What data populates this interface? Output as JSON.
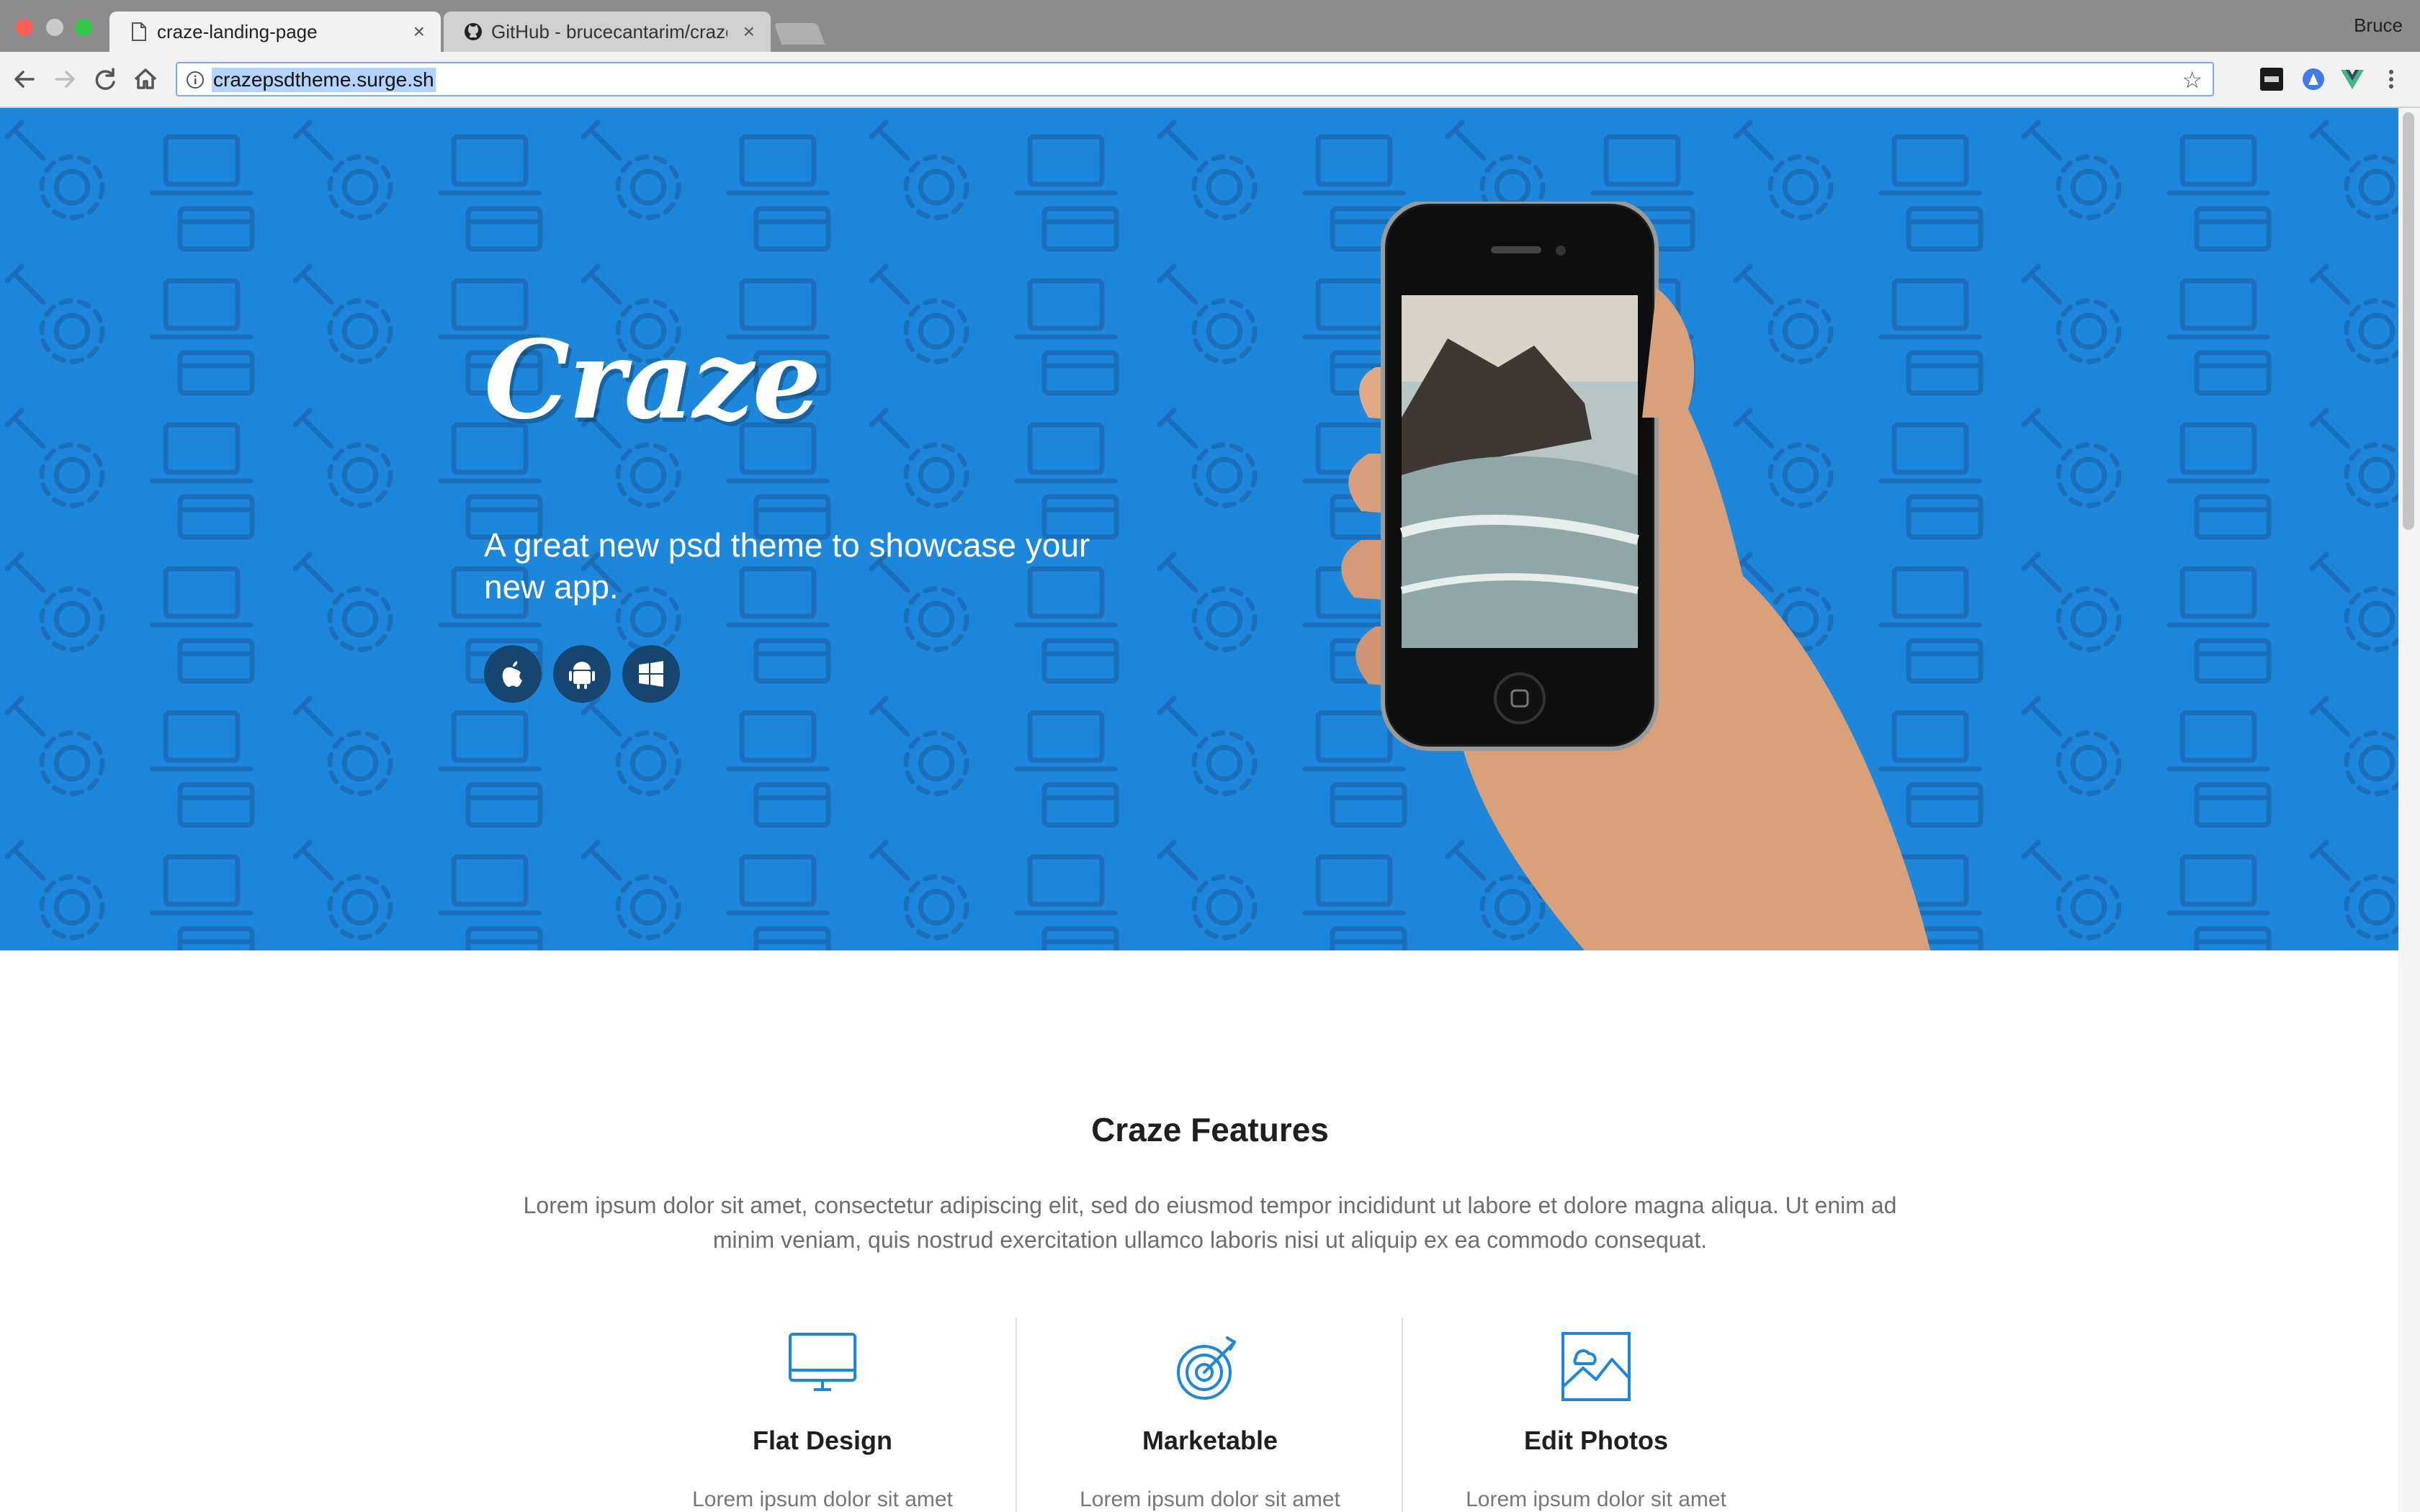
{
  "browser": {
    "tabs": [
      {
        "title": "craze-landing-page",
        "active": true
      },
      {
        "title": "GitHub - brucecantarim/craze-",
        "active": false
      }
    ],
    "profile_name": "Bruce",
    "url": "crazepsdtheme.surge.sh",
    "close_glyph": "×",
    "extensions": [
      "digg-icon",
      "vpn-icon",
      "vue-icon",
      "menu-icon"
    ]
  },
  "hero": {
    "logo": "Craze",
    "tagline": "A great new psd theme to showcase your new app.",
    "store_buttons": [
      "apple-icon",
      "android-icon",
      "windows-icon"
    ],
    "background_color": "#1c87db"
  },
  "features": {
    "title": "Craze Features",
    "description": "Lorem ipsum dolor sit amet, consectetur adipiscing elit, sed do eiusmod tempor incididunt ut labore et dolore magna aliqua. Ut enim ad minim veniam, quis nostrud exercitation ullamco laboris nisi ut aliquip ex ea commodo consequat.",
    "items": [
      {
        "icon": "monitor-icon",
        "title": "Flat Design",
        "text": "Lorem ipsum dolor sit amet"
      },
      {
        "icon": "target-icon",
        "title": "Marketable",
        "text": "Lorem ipsum dolor sit amet"
      },
      {
        "icon": "image-icon",
        "title": "Edit Photos",
        "text": "Lorem ipsum dolor sit amet"
      }
    ],
    "accent_color": "#1c87db"
  }
}
